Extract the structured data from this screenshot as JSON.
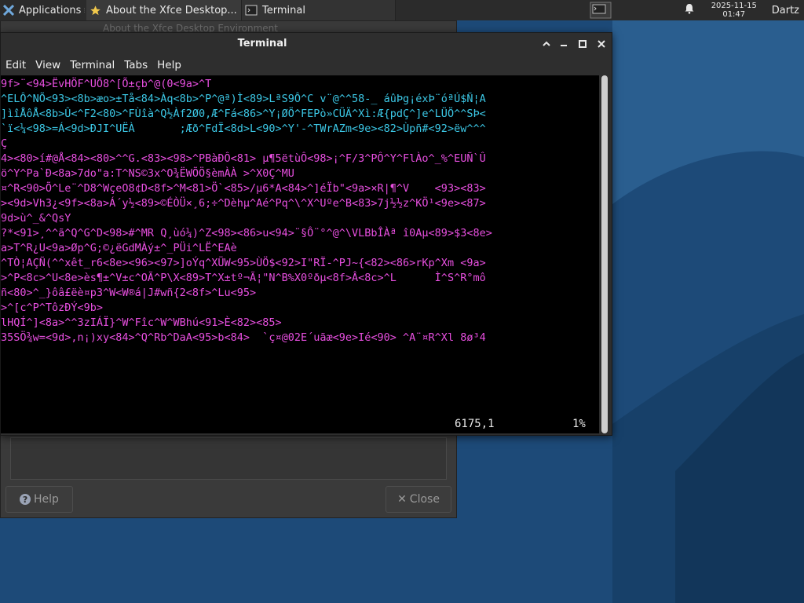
{
  "panel": {
    "applications_label": "Applications",
    "tasks": [
      {
        "label": "About the Xfce Desktop..."
      },
      {
        "label": "Terminal"
      }
    ],
    "clock_date": "2025-11-15",
    "clock_time": "01:47",
    "user": "Dartz"
  },
  "about": {
    "title": "About the Xfce Desktop Environment",
    "help_label": "Help",
    "close_label": "Close"
  },
  "terminal": {
    "title": "Terminal",
    "menus": [
      "Edit",
      "View",
      "Terminal",
      "Tabs",
      "Help"
    ],
    "lines": [
      "9f>¨<94>ËvHÖF^UÕ8^[Õ±çb^@(0<9a>^T",
      "^ELÔ^NÕ<93><8b>æo>±Tå<84>Àq<8b>^P^@ª)Ì<89>LªS9Ô^C v¨@^^58-_ áûÞg¡éxÞ¨óªÚ$Ñ¦A",
      "]ìîÅôÅ<8b>Û<^F2<80>^FÙîà^Q½Àf2Ø0,Æ^Fá<86>^Y¡ØÖ^FEPò»CÜÄ^Xì:Æ{pdÇ^]e^LÜÖ^^SÞ<",
      "`ï<¼<98>=Á<9d>ÐJI^UËÀ       ;Æð^FdÏ<8d>L<90>^Y'-^TWrAZm<9e><82>Ùpñ#<92>ëw^^^",
      "Ç",
      "4><80>í#@Å<84><80>^^G.<83><98>^PBàÐÔ<81> µ¶5ëtùÔ<98>¡^F/3^PÔ^Y^FlÀo^_%^EUÑ`Û",
      "ö^Y^Pa`Ð<8a>7do\"a:T^NS©3x^O¾ËWÕÖ§èmÀÀ >^X0Ç^MU",
      "¤^R<90>Õ^Le¨^D8^WçeO8¢D<8f>^M<81>Ö`<85>/µ6*A<84>^]éÏb\"<9a>×R|¶^V    <93><83>",
      "><9d>Vh3¿<9f><8a>Á´y½<89>©ÉÒÜ×¸6;÷^Dèhµ^Aé^Pq^\\^X^Uºe^B<83>7j½½z^KÖ¹<9e><87>",
      "9d>ù^_&^QsY",
      "?*<91>¸^^ã^Q^G^D<98>#^MR Q¸ùó¼)^Z<98><86>u<94>¨§Ô¨°^@^\\VLBbÎÀª î0Aµ<89>$3<8e>",
      "a>T^R¿U<9a>Øp^G;©¿ëGdMÀý±^_PÜi^LË^EAè",
      "^TÒ¦AÇÑ(^^xêt_r6<8e><96><97>]oÝq^XÜW<95>ÙÖ$<92>I\"RÏ-^PJ~{<82><86>rKp^Xm <9a>",
      ">^P<8c>^U<8e>ès¶±^V±c^OÃ^P\\X<89>T^X±tº¬Ã¦\"N^B%X0ºðµ<8f>Â<8c>^L      Ì^S^R°mô",
      "ñ<80>^_}ôâ£ëè¤p3^W<W®á|J#wñ{2<8f>^Lu<95>",
      ">^[c^P^TôzÐÝ<9b>",
      "lHQÍ^]<8a>^^3zIÁÏ}^W^Fîc^W^WBhú<91>È<82><85>",
      "35SÖ¾w=<9d>,n¡)xy<84>^Q^Rb^DaA<95>b<84>  `ç¤@02E´uãæ<9e>Ié<90> ^A¨¤R^Xl 8ø³4"
    ],
    "status_position": "6175,1",
    "status_percent": "1%"
  }
}
